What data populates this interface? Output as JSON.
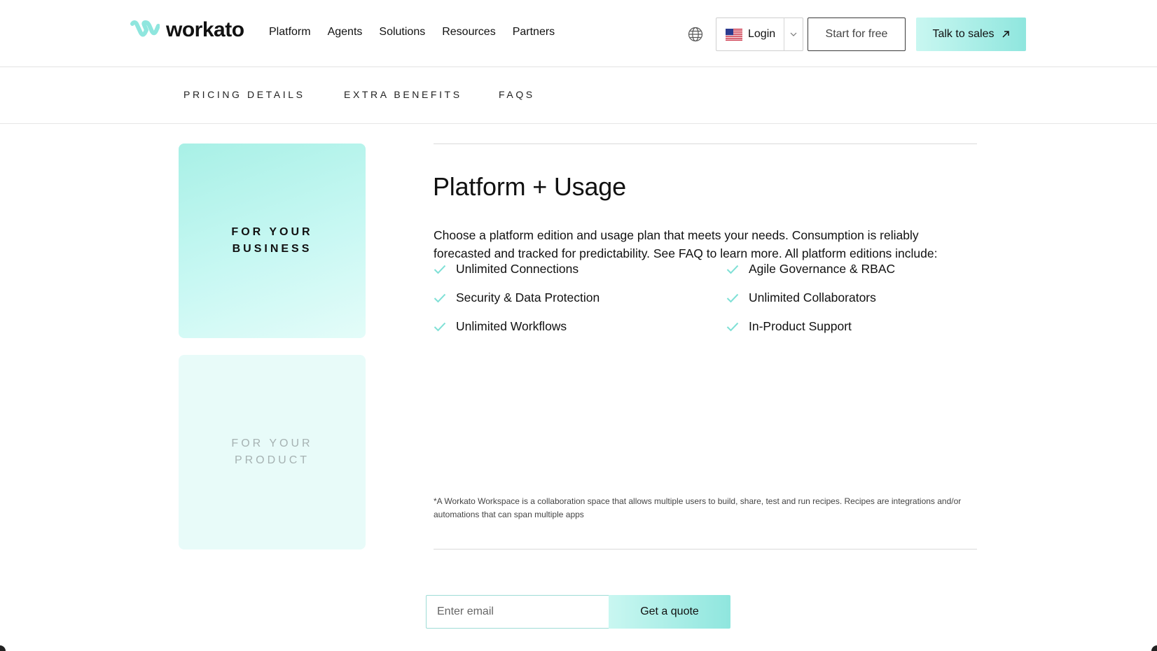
{
  "brand": {
    "name": "workato",
    "accent": "#8fe6de",
    "accent_light": "#c9f7f1"
  },
  "nav": {
    "items": [
      "Platform",
      "Agents",
      "Solutions",
      "Resources",
      "Partners"
    ]
  },
  "header": {
    "globe_icon": "globe-icon",
    "flag_icon": "us-flag-icon",
    "login_label": "Login",
    "start_label": "Start for free",
    "sales_label": "Talk to sales",
    "sales_icon": "arrow-up-right-icon"
  },
  "subnav": {
    "items": [
      "PRICING DETAILS",
      "EXTRA BENEFITS",
      "FAQS"
    ]
  },
  "cards": {
    "business": "FOR YOUR BUSINESS",
    "product": "FOR YOUR PRODUCT"
  },
  "main": {
    "title": "Platform + Usage",
    "description": "Choose a platform edition and usage plan that meets your needs. Consumption is reliably forecasted and tracked for predictability. See FAQ to learn more. All platform editions include:",
    "features": [
      "Unlimited Connections",
      "Agile Governance & RBAC",
      "Security & Data Protection",
      "Unlimited Collaborators",
      "Unlimited Workflows",
      "In-Product Support"
    ],
    "footnote": "*A Workato Workspace is a collaboration space that allows multiple users to build, share, test and run recipes. Recipes are integrations and/or automations that can span multiple apps"
  },
  "form": {
    "email_placeholder": "Enter email",
    "button_label": "Get a quote"
  }
}
